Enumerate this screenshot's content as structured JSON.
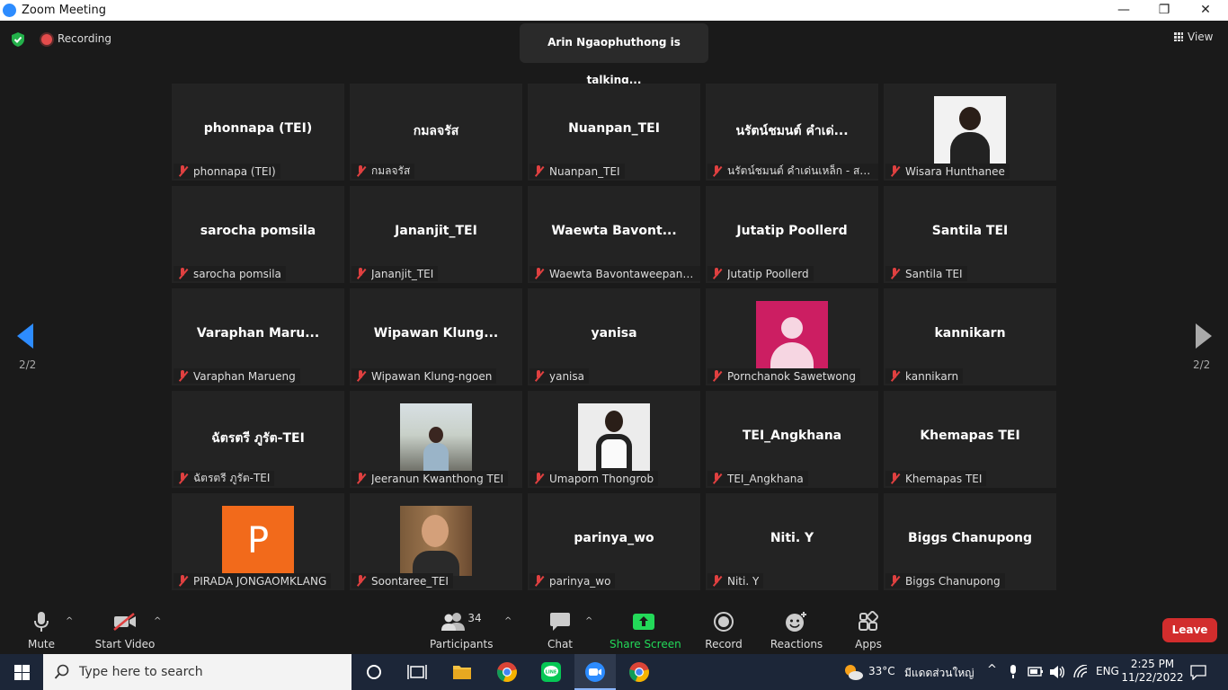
{
  "window": {
    "title": "Zoom Meeting",
    "minimize": "—",
    "restore": "❐",
    "close": "✕"
  },
  "status": {
    "recording": "Recording",
    "talking": "Arin Ngaophuthong is talking...",
    "view": "View"
  },
  "pagination": {
    "left": "2/2",
    "right": "2/2"
  },
  "tiles": [
    {
      "name": "phonnapa (TEI)",
      "label": "phonnapa (TEI)"
    },
    {
      "name": "กมลจรัส",
      "label": "กมลจรัส"
    },
    {
      "name": "Nuanpan_TEI",
      "label": "Nuanpan_TEI"
    },
    {
      "name": "นรัตน์ชมนต์ คำเด่...",
      "label": "นรัตน์ชมนต์ คำเด่นเหล็ก - สถา..."
    },
    {
      "name": "",
      "label": "Wisara Hunthanee"
    },
    {
      "name": "sarocha pomsila",
      "label": "sarocha pomsila"
    },
    {
      "name": "Jananjit_TEI",
      "label": "Jananjit_TEI"
    },
    {
      "name": "Waewta  Bavont...",
      "label": "Waewta Bavontaweepanya_..."
    },
    {
      "name": "Jutatip  Poollerd",
      "label": "Jutatip  Poollerd"
    },
    {
      "name": "Santila TEI",
      "label": "Santila TEI"
    },
    {
      "name": "Varaphan  Maru...",
      "label": "Varaphan Marueng"
    },
    {
      "name": "Wipawan  Klung...",
      "label": "Wipawan Klung-ngoen"
    },
    {
      "name": "yanisa",
      "label": "yanisa"
    },
    {
      "name": "",
      "label": "Pornchanok Sawetwong"
    },
    {
      "name": "kannikarn",
      "label": "kannikarn"
    },
    {
      "name": "ฉัตรตรี ภูรัต-TEI",
      "label": "ฉัตรตรี ภูรัต-TEI"
    },
    {
      "name": "",
      "label": "Jeeranun Kwanthong TEI"
    },
    {
      "name": "",
      "label": "Umaporn Thongrob"
    },
    {
      "name": "TEI_Angkhana",
      "label": "TEI_Angkhana"
    },
    {
      "name": "Khemapas TEI",
      "label": "Khemapas TEI"
    },
    {
      "name": "",
      "label": "PIRADA JONGAOMKLANG",
      "initial": "P"
    },
    {
      "name": "",
      "label": "Soontaree_TEI"
    },
    {
      "name": "parinya_wo",
      "label": "parinya_wo"
    },
    {
      "name": "Niti. Y",
      "label": "Niti. Y"
    },
    {
      "name": "Biggs Chanupong",
      "label": "Biggs Chanupong"
    }
  ],
  "toolbar": {
    "mute": "Mute",
    "start_video": "Start Video",
    "participants": "Participants",
    "participants_count": "34",
    "chat": "Chat",
    "share_screen": "Share Screen",
    "record": "Record",
    "reactions": "Reactions",
    "apps": "Apps",
    "leave": "Leave"
  },
  "taskbar": {
    "search_placeholder": "Type here to search",
    "weather_temp": "33°C",
    "weather_text": "มีแดดส่วนใหญ่",
    "language": "ENG",
    "time": "2:25 PM",
    "date": "11/22/2022"
  },
  "colors": {
    "accent": "#2d8cff",
    "share": "#23d959",
    "leave": "#d22d2d",
    "muted": "#e04040"
  }
}
